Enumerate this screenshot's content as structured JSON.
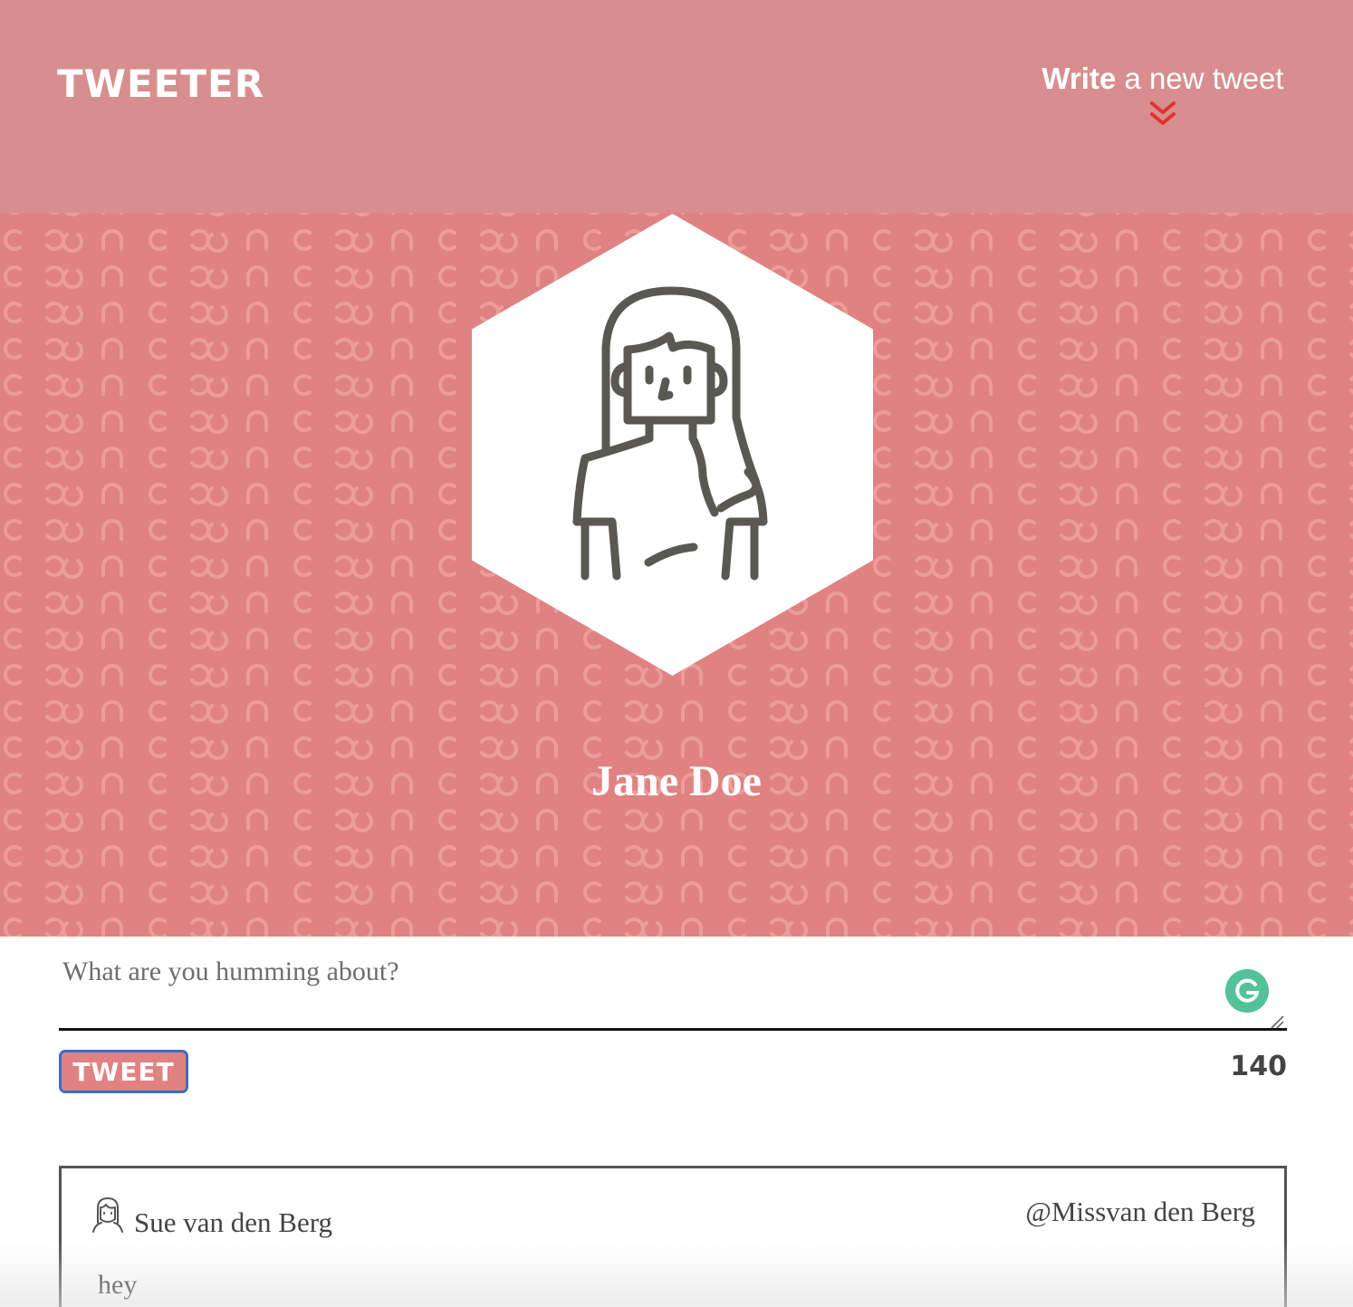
{
  "nav": {
    "brand": "TWEETER",
    "compose_bold": "Write",
    "compose_rest": " a new tweet",
    "compose_icon": "double-chevron-down-icon"
  },
  "profile": {
    "display_name": "Jane Doe",
    "avatar_icon": "woman-avatar-icon"
  },
  "composer": {
    "placeholder": "What are you humming about?",
    "value": "",
    "button_label": "TWEET",
    "char_counter": "140",
    "grammarly_icon": "grammarly-g-icon"
  },
  "tweets": [
    {
      "author": "Sue van den Berg",
      "handle": "@Missvan den Berg",
      "content": "hey",
      "avatar_icon": "woman-avatar-icon"
    }
  ],
  "colors": {
    "nav_bg": "#d88e8e",
    "profile_bg": "#e08282",
    "accent_red": "#e0332f",
    "button_border": "#3b6fc5",
    "grammarly_green": "#52c29a"
  }
}
